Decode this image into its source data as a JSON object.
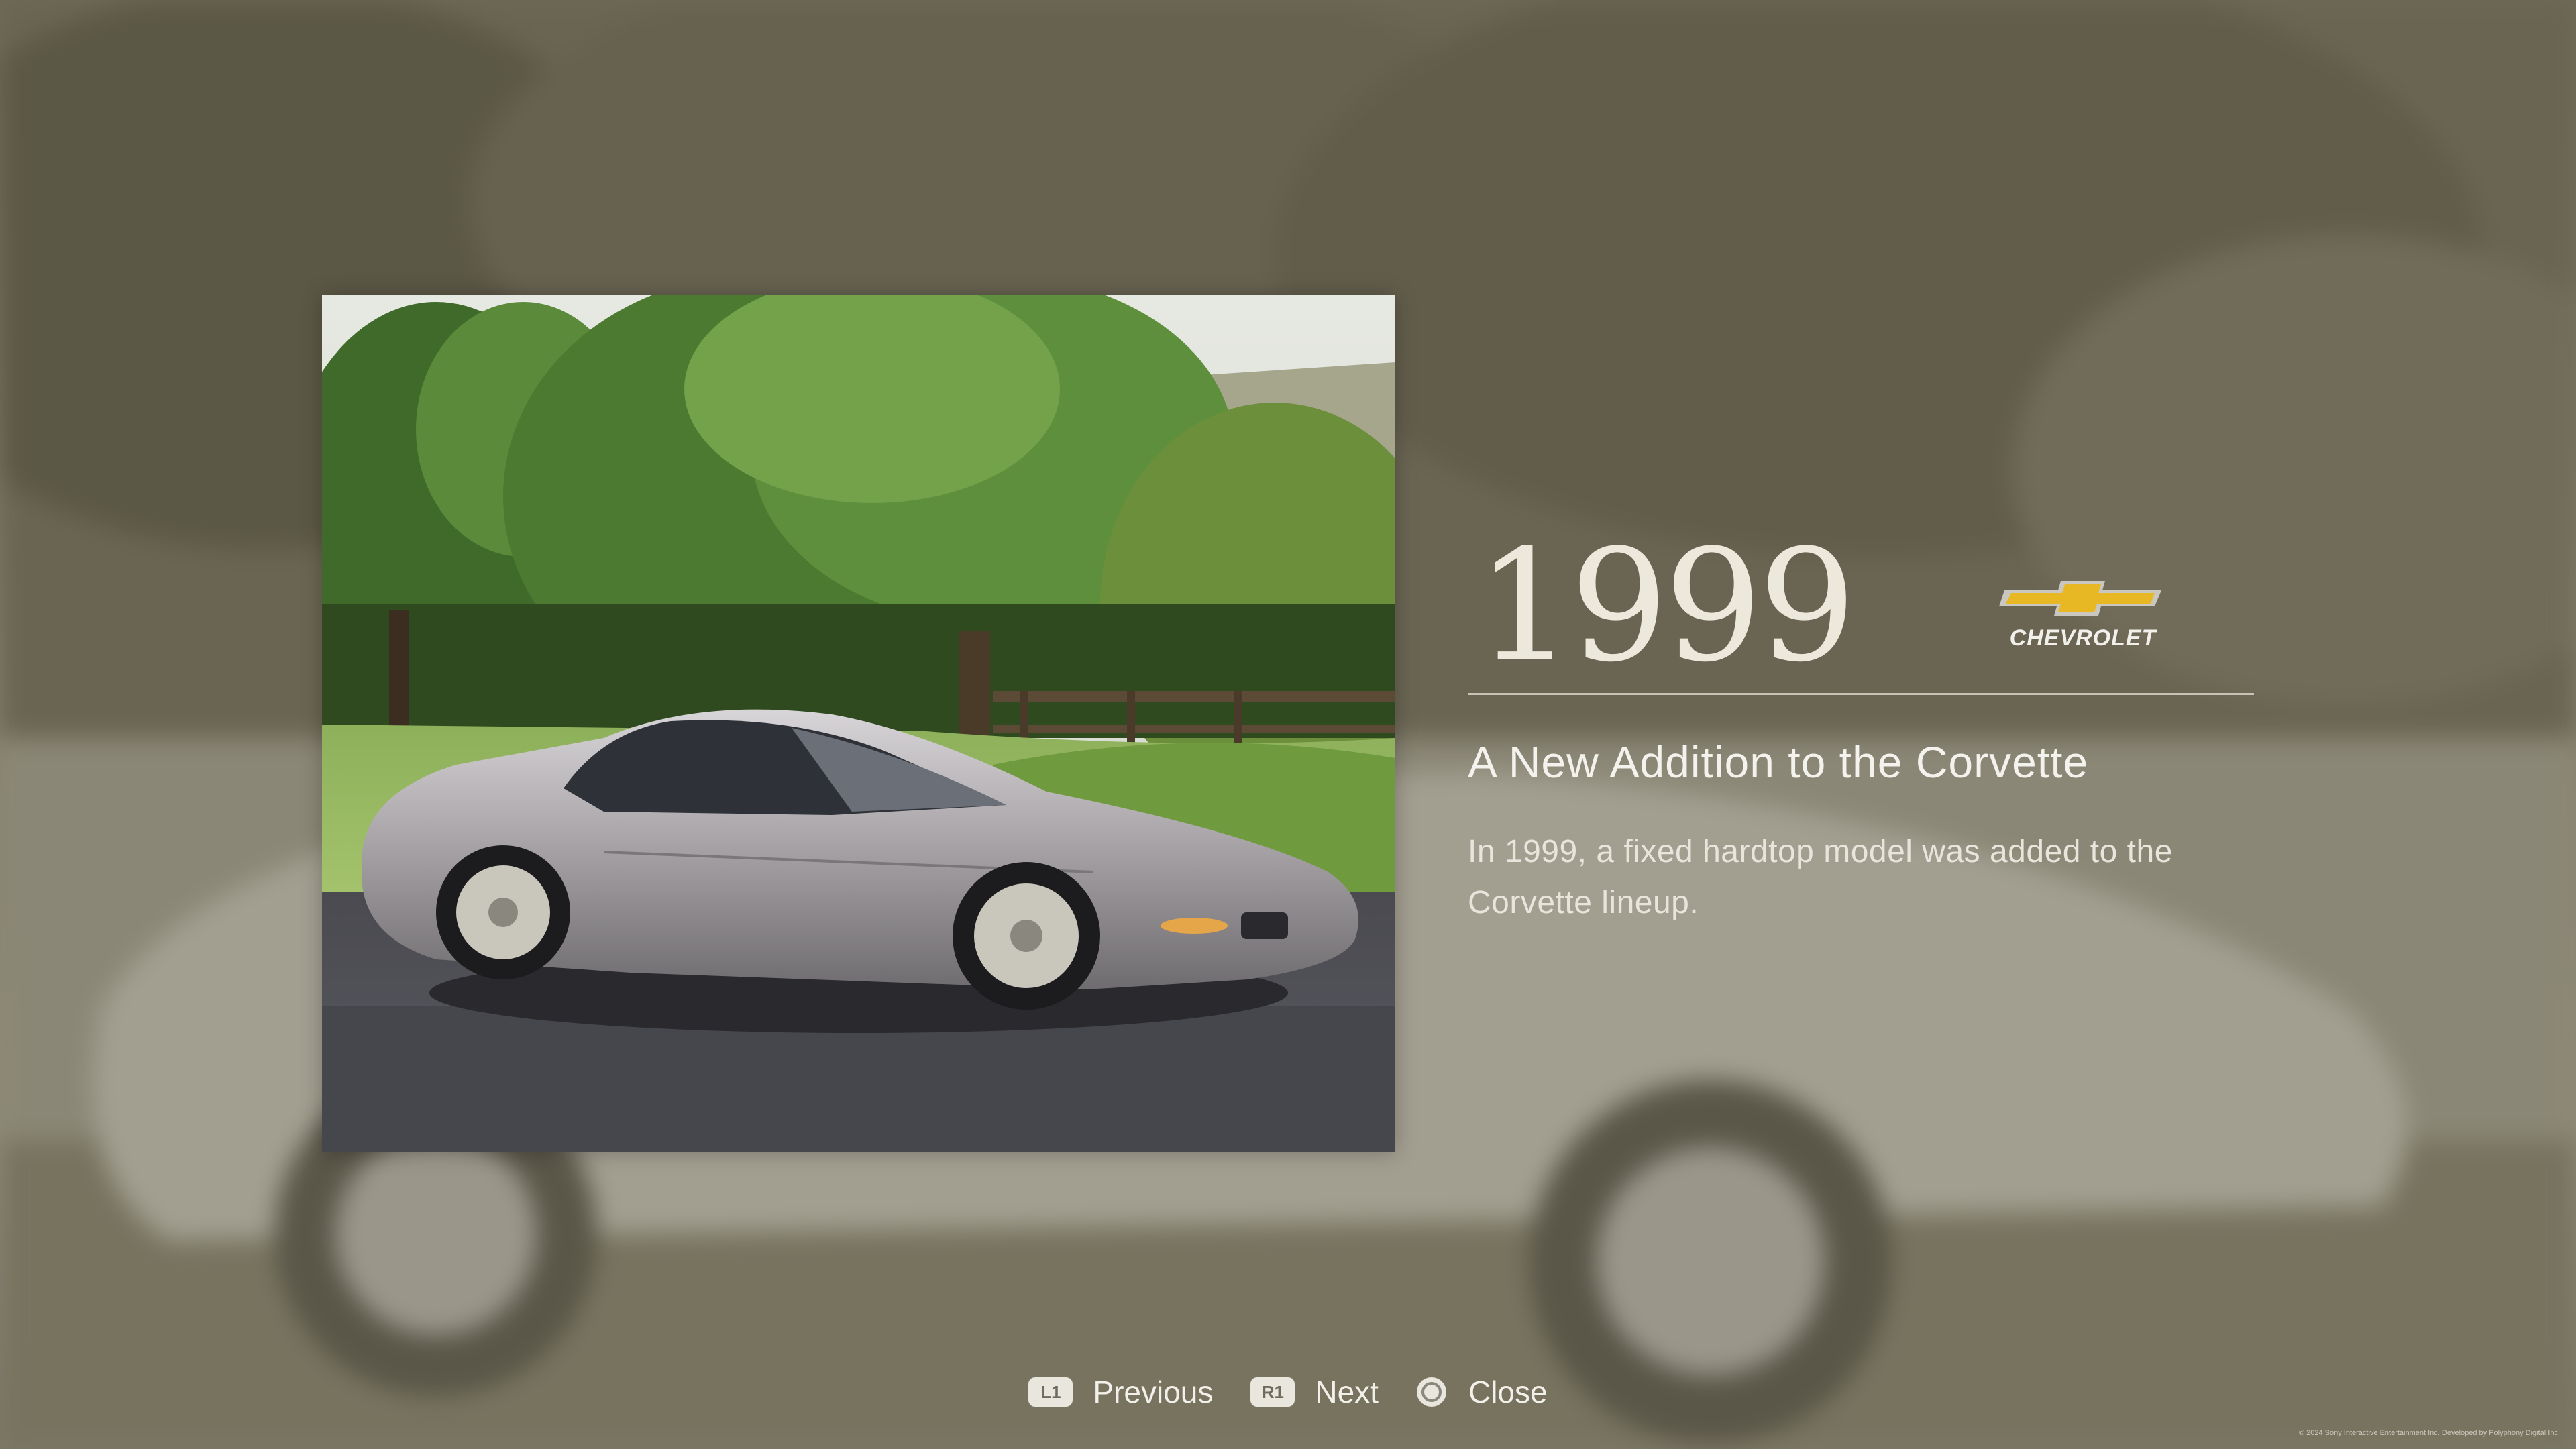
{
  "entry": {
    "year": "1999",
    "brand": "CHEVROLET",
    "title": "A New Addition to the Corvette",
    "description": "In 1999, a fixed hardtop model was added to the Corvette lineup."
  },
  "controls": {
    "previous": {
      "key": "L1",
      "label": "Previous"
    },
    "next": {
      "key": "R1",
      "label": "Next"
    },
    "close": {
      "icon": "circle-button-icon",
      "label": "Close"
    }
  },
  "footer": {
    "copyright": "© 2024 Sony Interactive Entertainment Inc. Developed by Polyphony Digital Inc."
  },
  "colors": {
    "bowtie_gold": "#e8b824",
    "car_silver": "#a7a3a6",
    "text": "#f2f0ea"
  }
}
